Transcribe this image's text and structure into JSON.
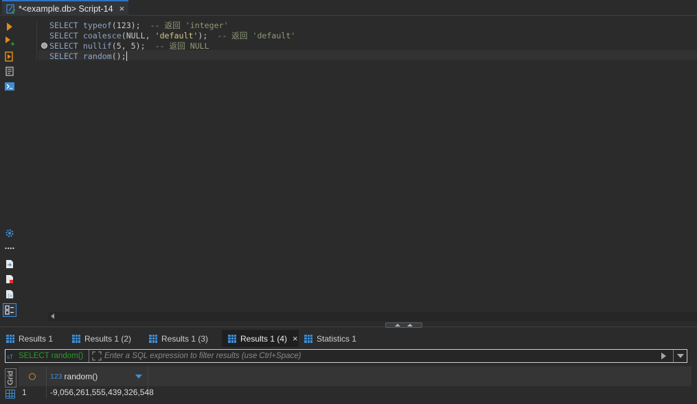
{
  "editor_tab": {
    "title": "*<example.db> Script-14",
    "icon": "sql-script-icon",
    "close_icon": "×"
  },
  "left_toolbar": [
    {
      "icon": "execute-statement-icon"
    },
    {
      "icon": "execute-in-new-tab-icon"
    },
    {
      "icon": "execute-script-icon"
    },
    {
      "icon": "explain-plan-icon"
    },
    {
      "icon": "console-icon"
    },
    {
      "icon": "settings-icon"
    },
    {
      "icon": "more-dots-icon"
    },
    {
      "icon": "export-icon"
    },
    {
      "icon": "import-icon"
    },
    {
      "icon": "variables-icon"
    },
    {
      "icon": "output-panel-icon"
    }
  ],
  "code_lines": [
    {
      "kw": "SELECT ",
      "fn": "typeof",
      "args": "(123);",
      "comment": "  -- 返回 'integer'"
    },
    {
      "kw": "SELECT ",
      "fn": "coalesce",
      "args": "(NULL, ",
      "str": "'default'",
      "args2": ");",
      "comment": "  -- 返回 'default'"
    },
    {
      "kw": "SELECT ",
      "fn": "nullif",
      "args": "(5, 5);",
      "comment": "  -- 返回 NULL"
    },
    {
      "kw": "SELECT ",
      "fn": "random",
      "args": "();"
    }
  ],
  "results_tabs": [
    {
      "label": "Results 1",
      "active": false,
      "closable": false
    },
    {
      "label": "Results 1 (2)",
      "active": false,
      "closable": false
    },
    {
      "label": "Results 1 (3)",
      "active": false,
      "closable": false
    },
    {
      "label": "Results 1 (4)",
      "active": true,
      "closable": true
    },
    {
      "label": "Statistics 1",
      "active": false,
      "closable": false
    }
  ],
  "filter": {
    "query": "SELECT random()",
    "placeholder": "Enter a SQL expression to filter results (use Ctrl+Space)",
    "value": ""
  },
  "grid": {
    "side_tab_label": "Grid",
    "columns": [
      {
        "type": "123",
        "name": "random()"
      }
    ],
    "rows": [
      {
        "num": "1",
        "values": [
          "-9,056,261,555,439,326,548"
        ]
      }
    ]
  },
  "colors": {
    "accent": "#3e8ed6",
    "background": "#2b2b2b",
    "toolbar_orange": "#e08a1e",
    "query_green": "#2c9b2c"
  }
}
